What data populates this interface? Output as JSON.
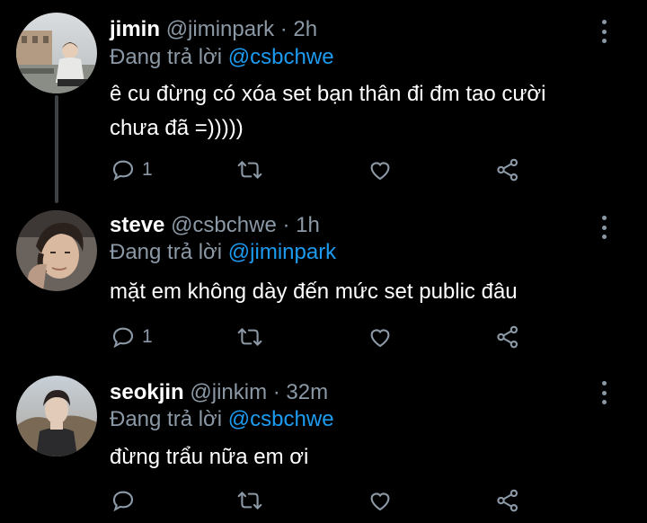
{
  "replies": [
    {
      "name": "jimin",
      "handle": "@jiminpark",
      "time": "2h",
      "reply_prefix": "Đang trả lời",
      "reply_to": "@csbchwe",
      "text_line1": "ê cu đừng có xóa set bạn thân đi đm tao cười",
      "text_line2": "chưa đã =)))))",
      "reply_count": "1"
    },
    {
      "name": "steve",
      "handle": "@csbchwe",
      "time": "1h",
      "reply_prefix": "Đang trả lời",
      "reply_to": "@jiminpark",
      "text_line1": "mặt em không dày đến mức set public đâu",
      "reply_count": "1"
    },
    {
      "name": "seokjin",
      "handle": "@jinkim",
      "time": "32m",
      "reply_prefix": "Đang trả lời",
      "reply_to": "@csbchwe",
      "text_line1": "đừng trẩu nữa em ơi",
      "reply_count": ""
    }
  ],
  "separator": "·",
  "colors": {
    "background": "#000000",
    "secondary_text": "#8b98a5",
    "mention": "#1d9bf0",
    "thread_line": "#3d4146"
  },
  "icons": [
    "reply-icon",
    "retweet-icon",
    "like-icon",
    "share-icon",
    "more-icon"
  ]
}
